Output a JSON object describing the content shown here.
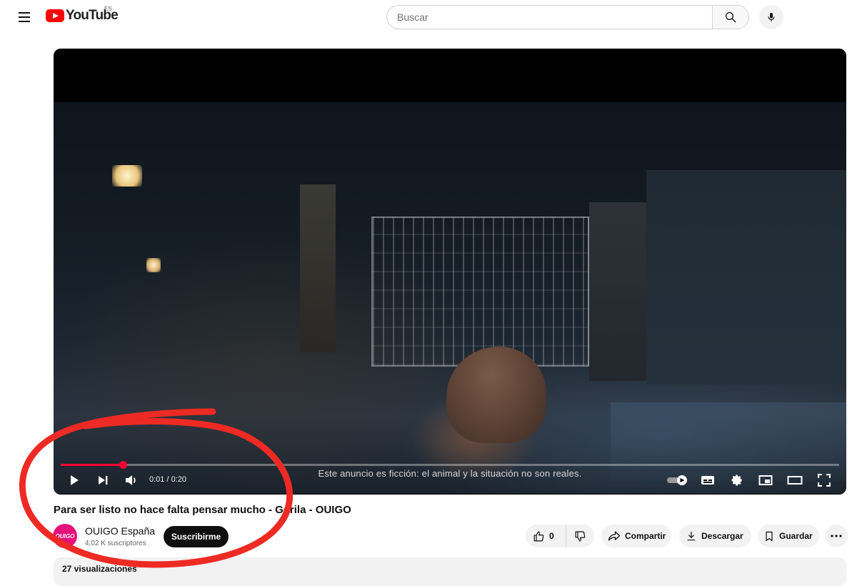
{
  "header": {
    "logo_text": "YouTube",
    "region": "ES",
    "search_placeholder": "Buscar"
  },
  "player": {
    "subtitle": "Este anuncio es ficción: el animal y la situación no son reales.",
    "time_current": "0:01",
    "time_separator": " / ",
    "time_total": "0:20",
    "progress": 0.08,
    "accent_color": "#ff0033"
  },
  "video": {
    "title": "Para ser listo no hace falta pensar mucho - Gorila - OUIGO"
  },
  "channel": {
    "name": "OUIGO España",
    "subscribers": "4,02 K suscriptores",
    "subscribe_label": "Suscribirme",
    "avatar_text": "OUIGO",
    "avatar_color": "#e4127a"
  },
  "actions": {
    "like_count": "0",
    "share_label": "Compartir",
    "download_label": "Descargar",
    "save_label": "Guardar"
  },
  "description": {
    "views": "27 visualizaciones"
  },
  "annotation": {
    "color": "#ee2a24"
  }
}
